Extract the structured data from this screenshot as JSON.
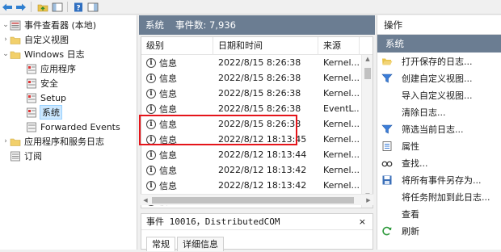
{
  "tree": {
    "items": [
      {
        "label": "事件查看器 (本地)",
        "expanded": true
      },
      {
        "label": "自定义视图",
        "expanded": false
      },
      {
        "label": "Windows 日志",
        "expanded": true
      },
      {
        "label": "应用程序"
      },
      {
        "label": "安全"
      },
      {
        "label": "Setup"
      },
      {
        "label": "系统",
        "selected": true
      },
      {
        "label": "Forwarded Events"
      },
      {
        "label": "应用程序和服务日志",
        "expanded": false
      },
      {
        "label": "订阅"
      }
    ]
  },
  "middle": {
    "log_name": "系统",
    "event_count": "事件数: 7,936"
  },
  "table": {
    "columns": [
      "级别",
      "日期和时间",
      "来源"
    ],
    "rows": [
      {
        "level": "信息",
        "datetime": "2022/8/15 8:26:38",
        "source": "Kernel..."
      },
      {
        "level": "信息",
        "datetime": "2022/8/15 8:26:38",
        "source": "Kernel..."
      },
      {
        "level": "信息",
        "datetime": "2022/8/15 8:26:38",
        "source": "Kernel..."
      },
      {
        "level": "信息",
        "datetime": "2022/8/15 8:26:38",
        "source": "EventL..."
      },
      {
        "level": "信息",
        "datetime": "2022/8/15 8:26:38",
        "source": "Kernel..."
      },
      {
        "level": "信息",
        "datetime": "2022/8/12 18:13:45",
        "source": "Kernel..."
      },
      {
        "level": "信息",
        "datetime": "2022/8/12 18:13:44",
        "source": "Kernel..."
      },
      {
        "level": "信息",
        "datetime": "2022/8/12 18:13:42",
        "source": "Kernel..."
      },
      {
        "level": "信息",
        "datetime": "2022/8/12 18:13:42",
        "source": "Kernel..."
      },
      {
        "level": "信息",
        "datetime": "2022/8/12 18:13:42",
        "source": "Kernel..."
      }
    ]
  },
  "detail": {
    "title": "事件 10016，DistributedCOM",
    "close": "×",
    "tabs": [
      "常规",
      "详细信息"
    ]
  },
  "actions": {
    "header": "操作",
    "section": "系统",
    "items": [
      {
        "label": "打开保存的日志...",
        "icon": "folder-open-icon"
      },
      {
        "label": "创建自定义视图...",
        "icon": "filter-icon"
      },
      {
        "label": "导入自定义视图...",
        "icon": "none"
      },
      {
        "label": "清除日志...",
        "icon": "none"
      },
      {
        "label": "筛选当前日志...",
        "icon": "filter-icon"
      },
      {
        "label": "属性",
        "icon": "properties-icon"
      },
      {
        "label": "查找...",
        "icon": "find-icon"
      },
      {
        "label": "将所有事件另存为...",
        "icon": "save-icon"
      },
      {
        "label": "将任务附加到此日志...",
        "icon": "none"
      },
      {
        "label": "查看",
        "icon": "none"
      },
      {
        "label": "刷新",
        "icon": "refresh-icon"
      }
    ]
  },
  "colors": {
    "header_bar": "#6b7d92",
    "highlight_box": "#e5141a",
    "selection": "#cce8ff"
  }
}
